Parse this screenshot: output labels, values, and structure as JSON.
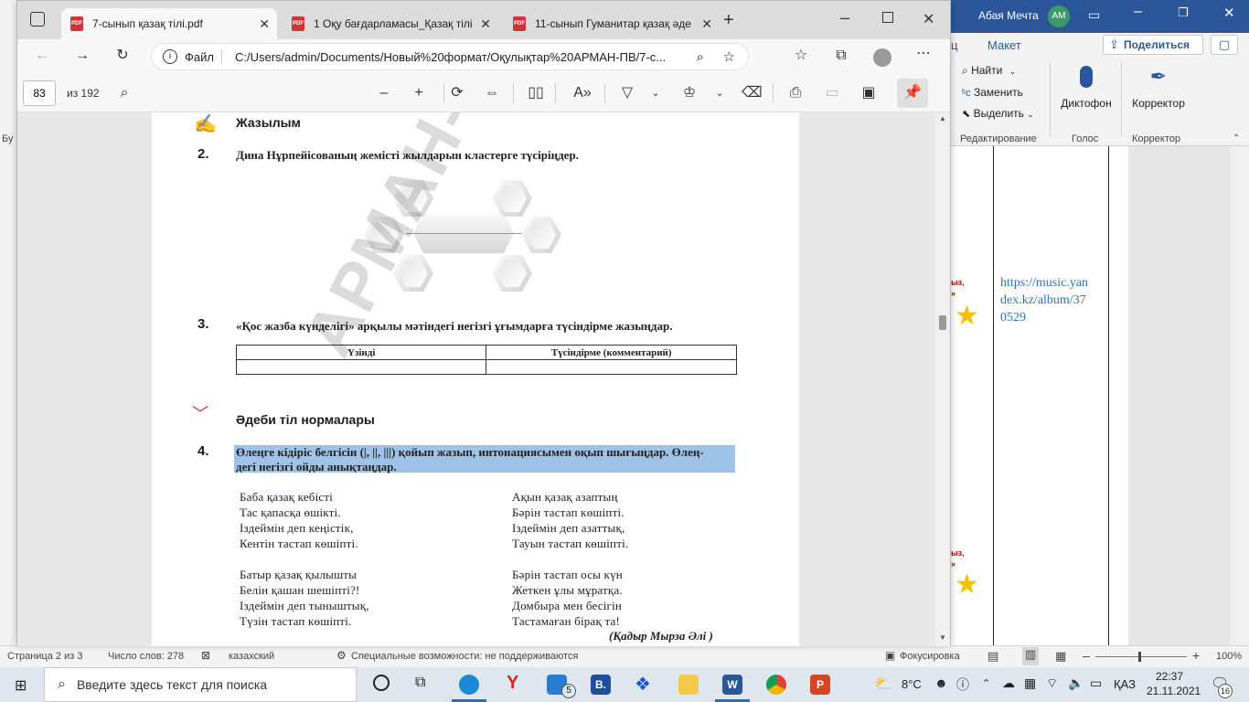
{
  "edge": {
    "tabs": [
      {
        "label": "7-сынып қазақ тілі.pdf",
        "active": true
      },
      {
        "label": "1 Оқу бағдарламасы_Қазақ тілі",
        "active": false
      },
      {
        "label": "11-сынып Гуманитар қазақ әде",
        "active": false
      }
    ],
    "address": {
      "scheme_label": "Файл",
      "url": "C:/Users/admin/Documents/Новый%20формат/Оқулықтар%20АРМАН-ПВ/7-с..."
    },
    "pdf_toolbar": {
      "page_number": "83",
      "page_total": "из 192"
    }
  },
  "word": {
    "user_name": "Абая Мечта",
    "user_initials": "АМ",
    "menu_fragment": "ц",
    "menu_layout": "Макет",
    "share_label": "Поделиться",
    "editing": {
      "find": "Найти",
      "replace": "Заменить",
      "select": "Выделить"
    },
    "groups": {
      "editing": "Редактирование",
      "voice": "Голос",
      "corrector": "Корректор"
    },
    "dictate_label": "Диктофон",
    "corrector_label": "Корректор",
    "left_fragment": "Бу",
    "doc_link": "https://music.yandex.kz/album/370529",
    "doc_link_lines": [
      "https://music.yan",
      "dex.kz/album/37",
      "0529"
    ],
    "red_fragments": [
      "ыз,",
      "»",
      "ыз,",
      "»"
    ],
    "status": {
      "page": "Страница 2 из 3",
      "words": "Число слов: 278",
      "language": "казахский",
      "accessibility": "Специальные возможности: не поддерживаются",
      "focus": "Фокусировка",
      "zoom": "100%"
    }
  },
  "pdf_page": {
    "section1_title": "Жазылым",
    "q2": {
      "num": "2.",
      "text": "Дина Нұрпейісованың жемісті жылдарын кластерге түсіріңдер."
    },
    "q3": {
      "num": "3.",
      "text": "«Қос жазба күнделігі» арқылы мәтіндегі негізгі ұғымдарға түсіндірме жазыңдар.",
      "table_headers": [
        "Үзінді",
        "Түсіндірме (комментарий)"
      ]
    },
    "section2_title": "Әдеби тіл нормалары",
    "q4": {
      "num": "4.",
      "line1": "Өлеңге кідіріс белгісін (|, ||, |||) қойып жазып, интонациясымен оқып шығыңдар. Өлең-",
      "line2": "дегі негізгі ойды анықтаңдар."
    },
    "poem_left": [
      "Баба қазақ кебісті",
      "Тас қапасқа өшікті.",
      "Іздеймін деп кеңістік,",
      "Кентін тастап көшіпті.",
      "",
      "Батыр қазақ қылышты",
      "Белін қашан шешіпті?!",
      "Іздеймін деп тыныштық,",
      "Түзін тастап көшіпті."
    ],
    "poem_right": [
      "Ақын қазақ азаптың",
      "Бәрін тастап көшіпті.",
      "Іздеймін деп азаттық,",
      "Тауын тастап көшіпті.",
      "",
      "Бәрін тастап осы күн",
      "Жеткен ұлы мұратқа.",
      "Домбыра мен бесігін",
      "Тастамаған бірақ та!"
    ],
    "author": "(Қадыр Мырза Әлі )",
    "watermark": "АРМАН-ПВ баспасы"
  },
  "taskbar": {
    "search_placeholder": "Введите здесь текст для поиска",
    "mail_badge": "5",
    "temperature": "8°C",
    "language": "ҚАЗ",
    "time": "22:37",
    "date": "21.11.2021",
    "notifications": "16"
  },
  "colors": {
    "word_blue": "#2b579a",
    "highlight": "#9ec3e6",
    "pdf_red": "#d13438"
  }
}
